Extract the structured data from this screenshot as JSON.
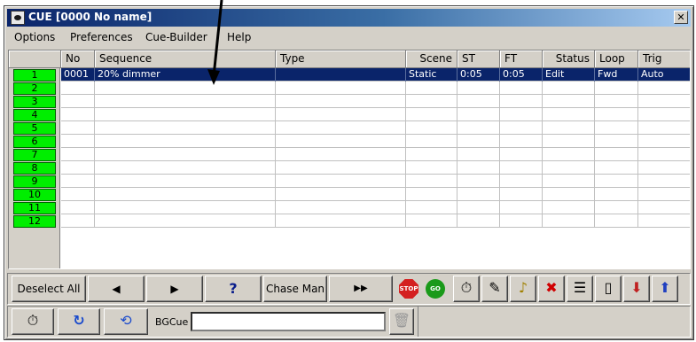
{
  "window": {
    "title": "CUE [0000 No name]",
    "close_label": "✕"
  },
  "menu": [
    "Options",
    "Preferences",
    "Cue-Builder",
    "Help"
  ],
  "columns": [
    "No",
    "Sequence",
    "Type",
    "Scene",
    "ST",
    "FT",
    "Status",
    "Loop",
    "Trig"
  ],
  "row_numbers": [
    "1",
    "2",
    "3",
    "4",
    "5",
    "6",
    "7",
    "8",
    "9",
    "10",
    "11",
    "12"
  ],
  "rows": [
    {
      "no": "0001",
      "sequence": "20% dimmer",
      "type": "",
      "scene": "Static",
      "st": "0:05",
      "ft": "0:05",
      "status": "Edit",
      "loop": "Fwd",
      "trig": "Auto",
      "selected": true
    }
  ],
  "toolbar1": {
    "deselect_all": "Deselect All",
    "prev": "◀",
    "next": "▶",
    "help": "?",
    "chase_man": "Chase Man",
    "fast_forward": "▶▶",
    "stop": "STOP",
    "go": "GO",
    "icons": [
      "timer-icon",
      "pen-icon",
      "speaker-icon",
      "delete-icon",
      "list-icon",
      "new-page-icon",
      "import-icon",
      "export-icon"
    ]
  },
  "toolbar2": {
    "bgcue_label": "BGCue",
    "bgcue_value": ""
  },
  "colors": {
    "row_number_bg": "#00ee00",
    "selection": "#0a246a",
    "title_bar": "#0a246a"
  }
}
